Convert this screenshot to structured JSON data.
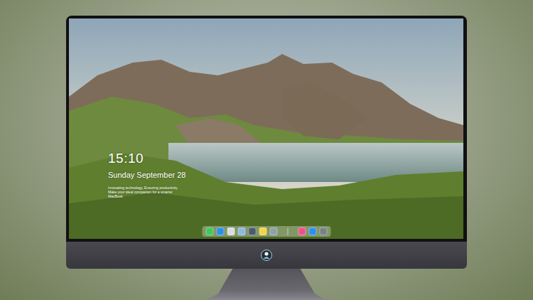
{
  "lock_screen": {
    "time": "15:10",
    "date": "Sunday September 28",
    "tagline": "Innovating technology, Ensuring productivity. Make your ideal companion for a smarter MacBook"
  },
  "dock": {
    "groups": [
      [
        {
          "color": "#3ec95a"
        },
        {
          "color": "#2f8fe8"
        },
        {
          "color": "#d9dde2"
        },
        {
          "color": "#8fb8e0"
        },
        {
          "color": "#4a5a70"
        },
        {
          "color": "#f5d44a"
        },
        {
          "color": "#8ea0a8"
        }
      ],
      [
        {
          "color": "#f0508a"
        },
        {
          "color": "#2d8ff0"
        },
        {
          "color": "#7a7f88"
        }
      ]
    ]
  }
}
